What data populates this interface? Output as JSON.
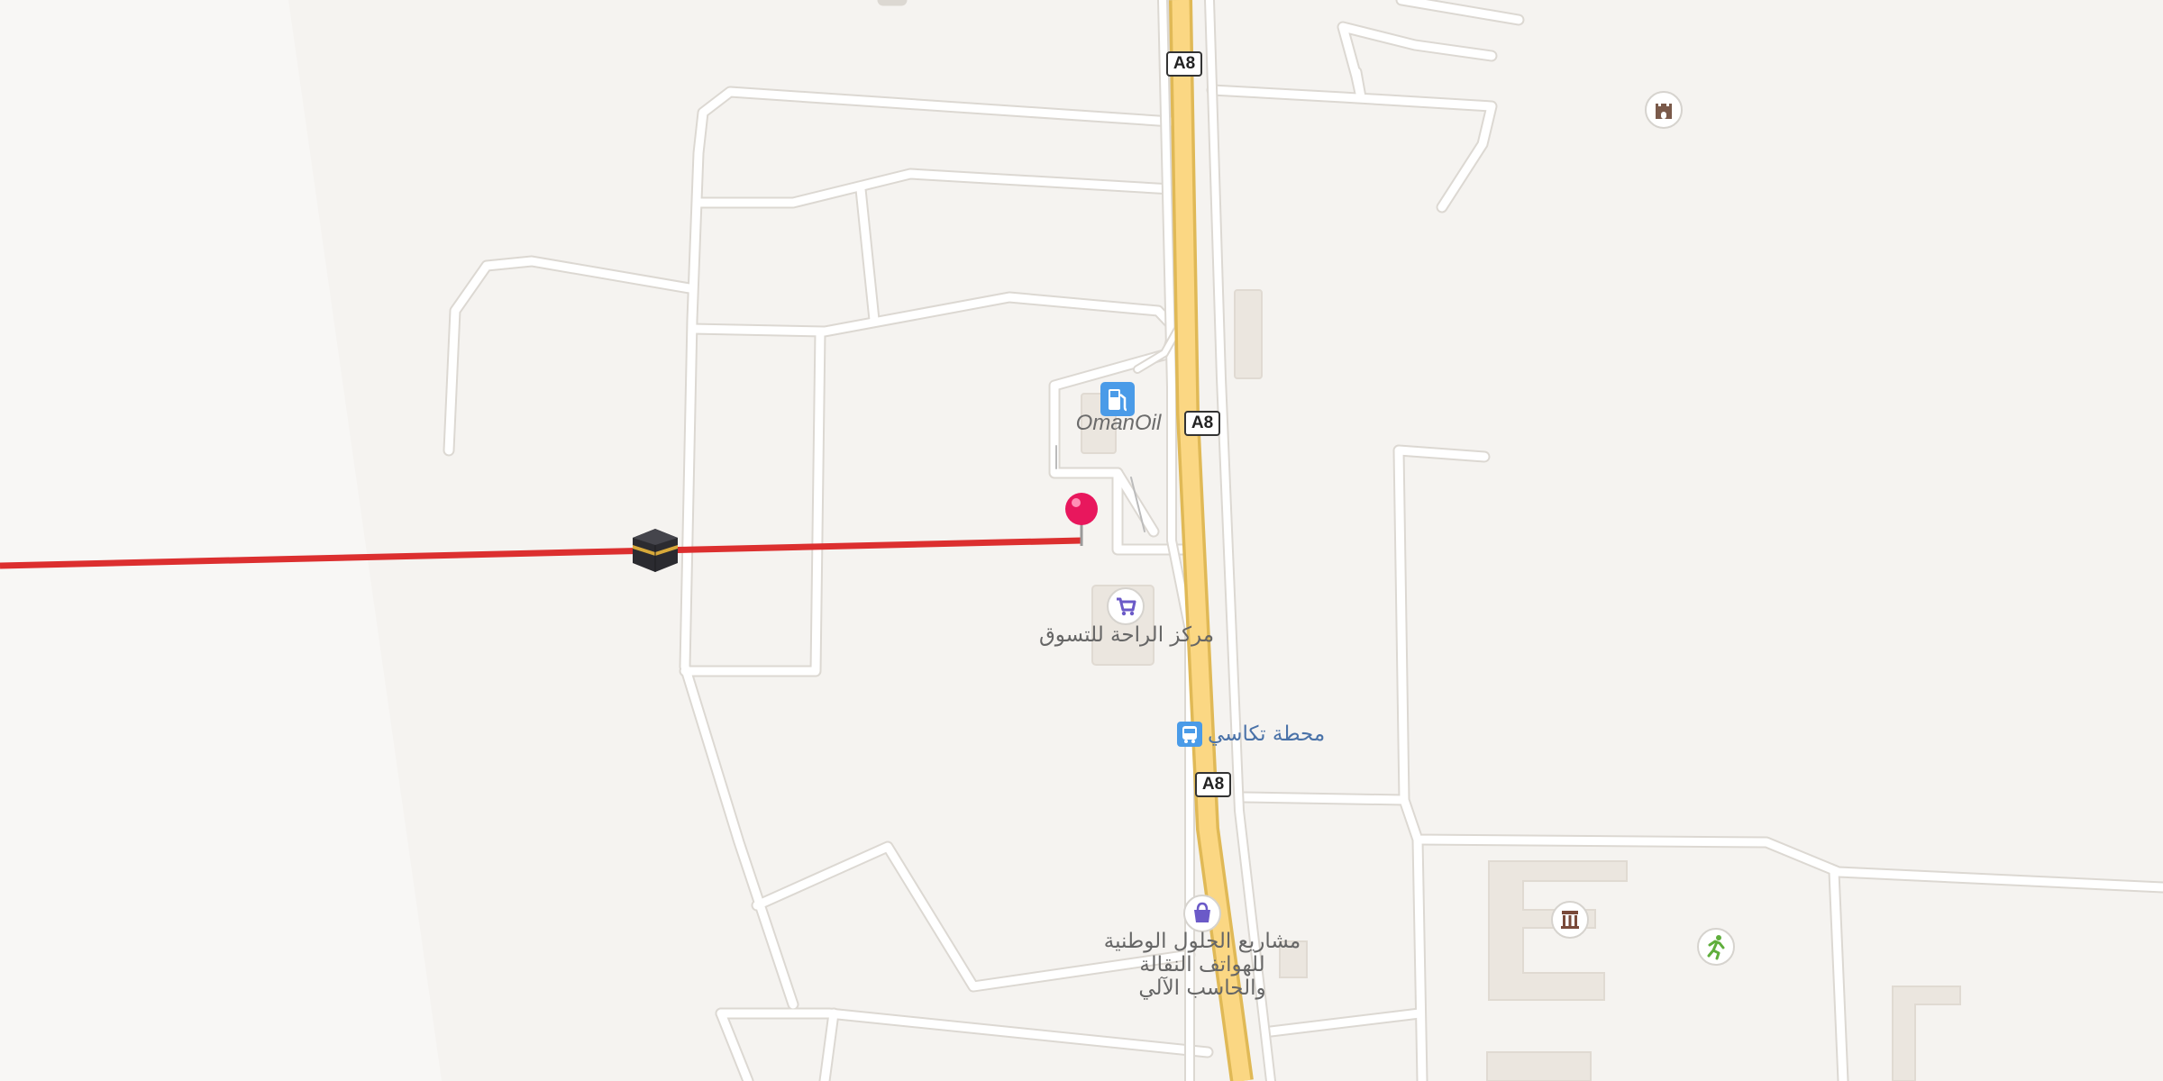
{
  "map": {
    "road_shield": "A8",
    "places": [
      {
        "id": "omanoil",
        "name": "OmanOil",
        "icon": "fuel-station-icon",
        "color": "#4a9be8"
      },
      {
        "id": "shopping-center",
        "name": "مركز الراحة للتسوق",
        "icon": "shopping-cart-icon",
        "color": "#6b5ac8"
      },
      {
        "id": "taxi-station",
        "name": "محطة تكاسي",
        "icon": "bus-icon",
        "color": "#4a9be8"
      },
      {
        "id": "jewelry-projects",
        "name_lines": [
          "مشاريع الحلول الوطنية",
          "للهواتف النقالة",
          "والحاسب الآلي"
        ],
        "icon": "shopping-bag-icon",
        "color": "#6b5ac8"
      },
      {
        "id": "fort",
        "icon": "castle-icon",
        "color": "#7a5a4a"
      },
      {
        "id": "museum",
        "icon": "museum-icon",
        "color": "#7a4a3a"
      },
      {
        "id": "sports",
        "icon": "running-person-icon",
        "color": "#5fae3c"
      }
    ],
    "pin": {
      "icon": "map-pin-icon",
      "color": "#e8175d"
    },
    "qibla": {
      "icon": "kaaba-icon",
      "line_color": "#dc2f2f"
    }
  }
}
